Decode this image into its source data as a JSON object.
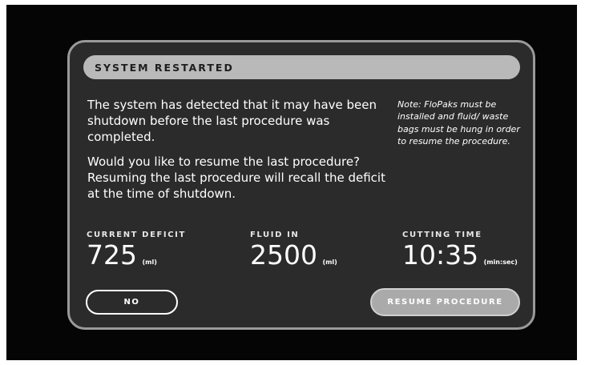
{
  "dialog": {
    "title": "SYSTEM RESTARTED",
    "message_p1": "The system has detected that it may have been shutdown before the last procedure was completed.",
    "message_p2": "Would you like to resume the last procedure? Resuming the last procedure will recall the deficit at the time of shutdown.",
    "note": "Note: FloPaks must be installed and fluid/ waste bags must be hung in order to resume the procedure."
  },
  "stats": {
    "current_deficit": {
      "label": "CURRENT DEFICIT",
      "value": "725",
      "unit": "(ml)"
    },
    "fluid_in": {
      "label": "FLUID IN",
      "value": "2500",
      "unit": "(ml)"
    },
    "cutting_time": {
      "label": "CUTTING TIME",
      "value": "10:35",
      "unit": "(min:sec)"
    }
  },
  "buttons": {
    "no_label": "NO",
    "resume_label": "RESUME PROCEDURE"
  },
  "colors": {
    "background": "#050505",
    "dialog": "#2b2b2b",
    "dialog_border": "#9a9a9a",
    "title_bar": "#b9b9b9",
    "resume_button": "#aaaaaa"
  }
}
